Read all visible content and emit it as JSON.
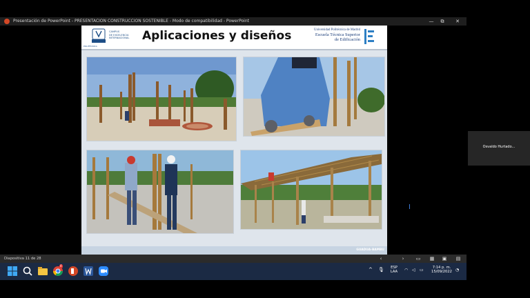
{
  "window": {
    "title": "Presentación de PowerPoint  -  PRESENTACION CONSTRUCCION SOSTENIBLE  -  Modo de compatibilidad - PowerPoint",
    "controls": [
      "—",
      "⧉",
      "✕"
    ]
  },
  "slide": {
    "title": "Aplicaciones y diseños",
    "campus_text": [
      "CAMPUS",
      "DE EXCELENCIA",
      "INTERNACIONAL"
    ],
    "logo_caption": "POLITÉCNICA",
    "university_line1": "Universidad Politécnica de Madrid",
    "university_line2": "Escuela Técnica Superior",
    "university_line3": "de Edificación",
    "footer_label": "GUADUA-BAMBU",
    "photos": [
      {
        "subject": "bamboo columns on construction site"
      },
      {
        "subject": "worker cutting bamboo pole"
      },
      {
        "subject": "workers assembling bamboo columns"
      },
      {
        "subject": "bamboo roof structure"
      }
    ]
  },
  "participant": {
    "name": "Osvaldo Hurtado..."
  },
  "statusbar": {
    "slide_counter": "Diapositiva 11 de 28"
  },
  "taskbar": {
    "apps": [
      "windows-start",
      "search",
      "file-explorer",
      "chrome",
      "powerpoint",
      "word",
      "zoom"
    ],
    "lang_line1": "ESP",
    "lang_line2": "LAA",
    "time": "7:14 p. m.",
    "date": "15/09/2022",
    "notification_count": "4"
  },
  "colors": {
    "accent": "#d24726",
    "taskbar": "#1b2a44",
    "header_blue": "#1d3f7a"
  }
}
